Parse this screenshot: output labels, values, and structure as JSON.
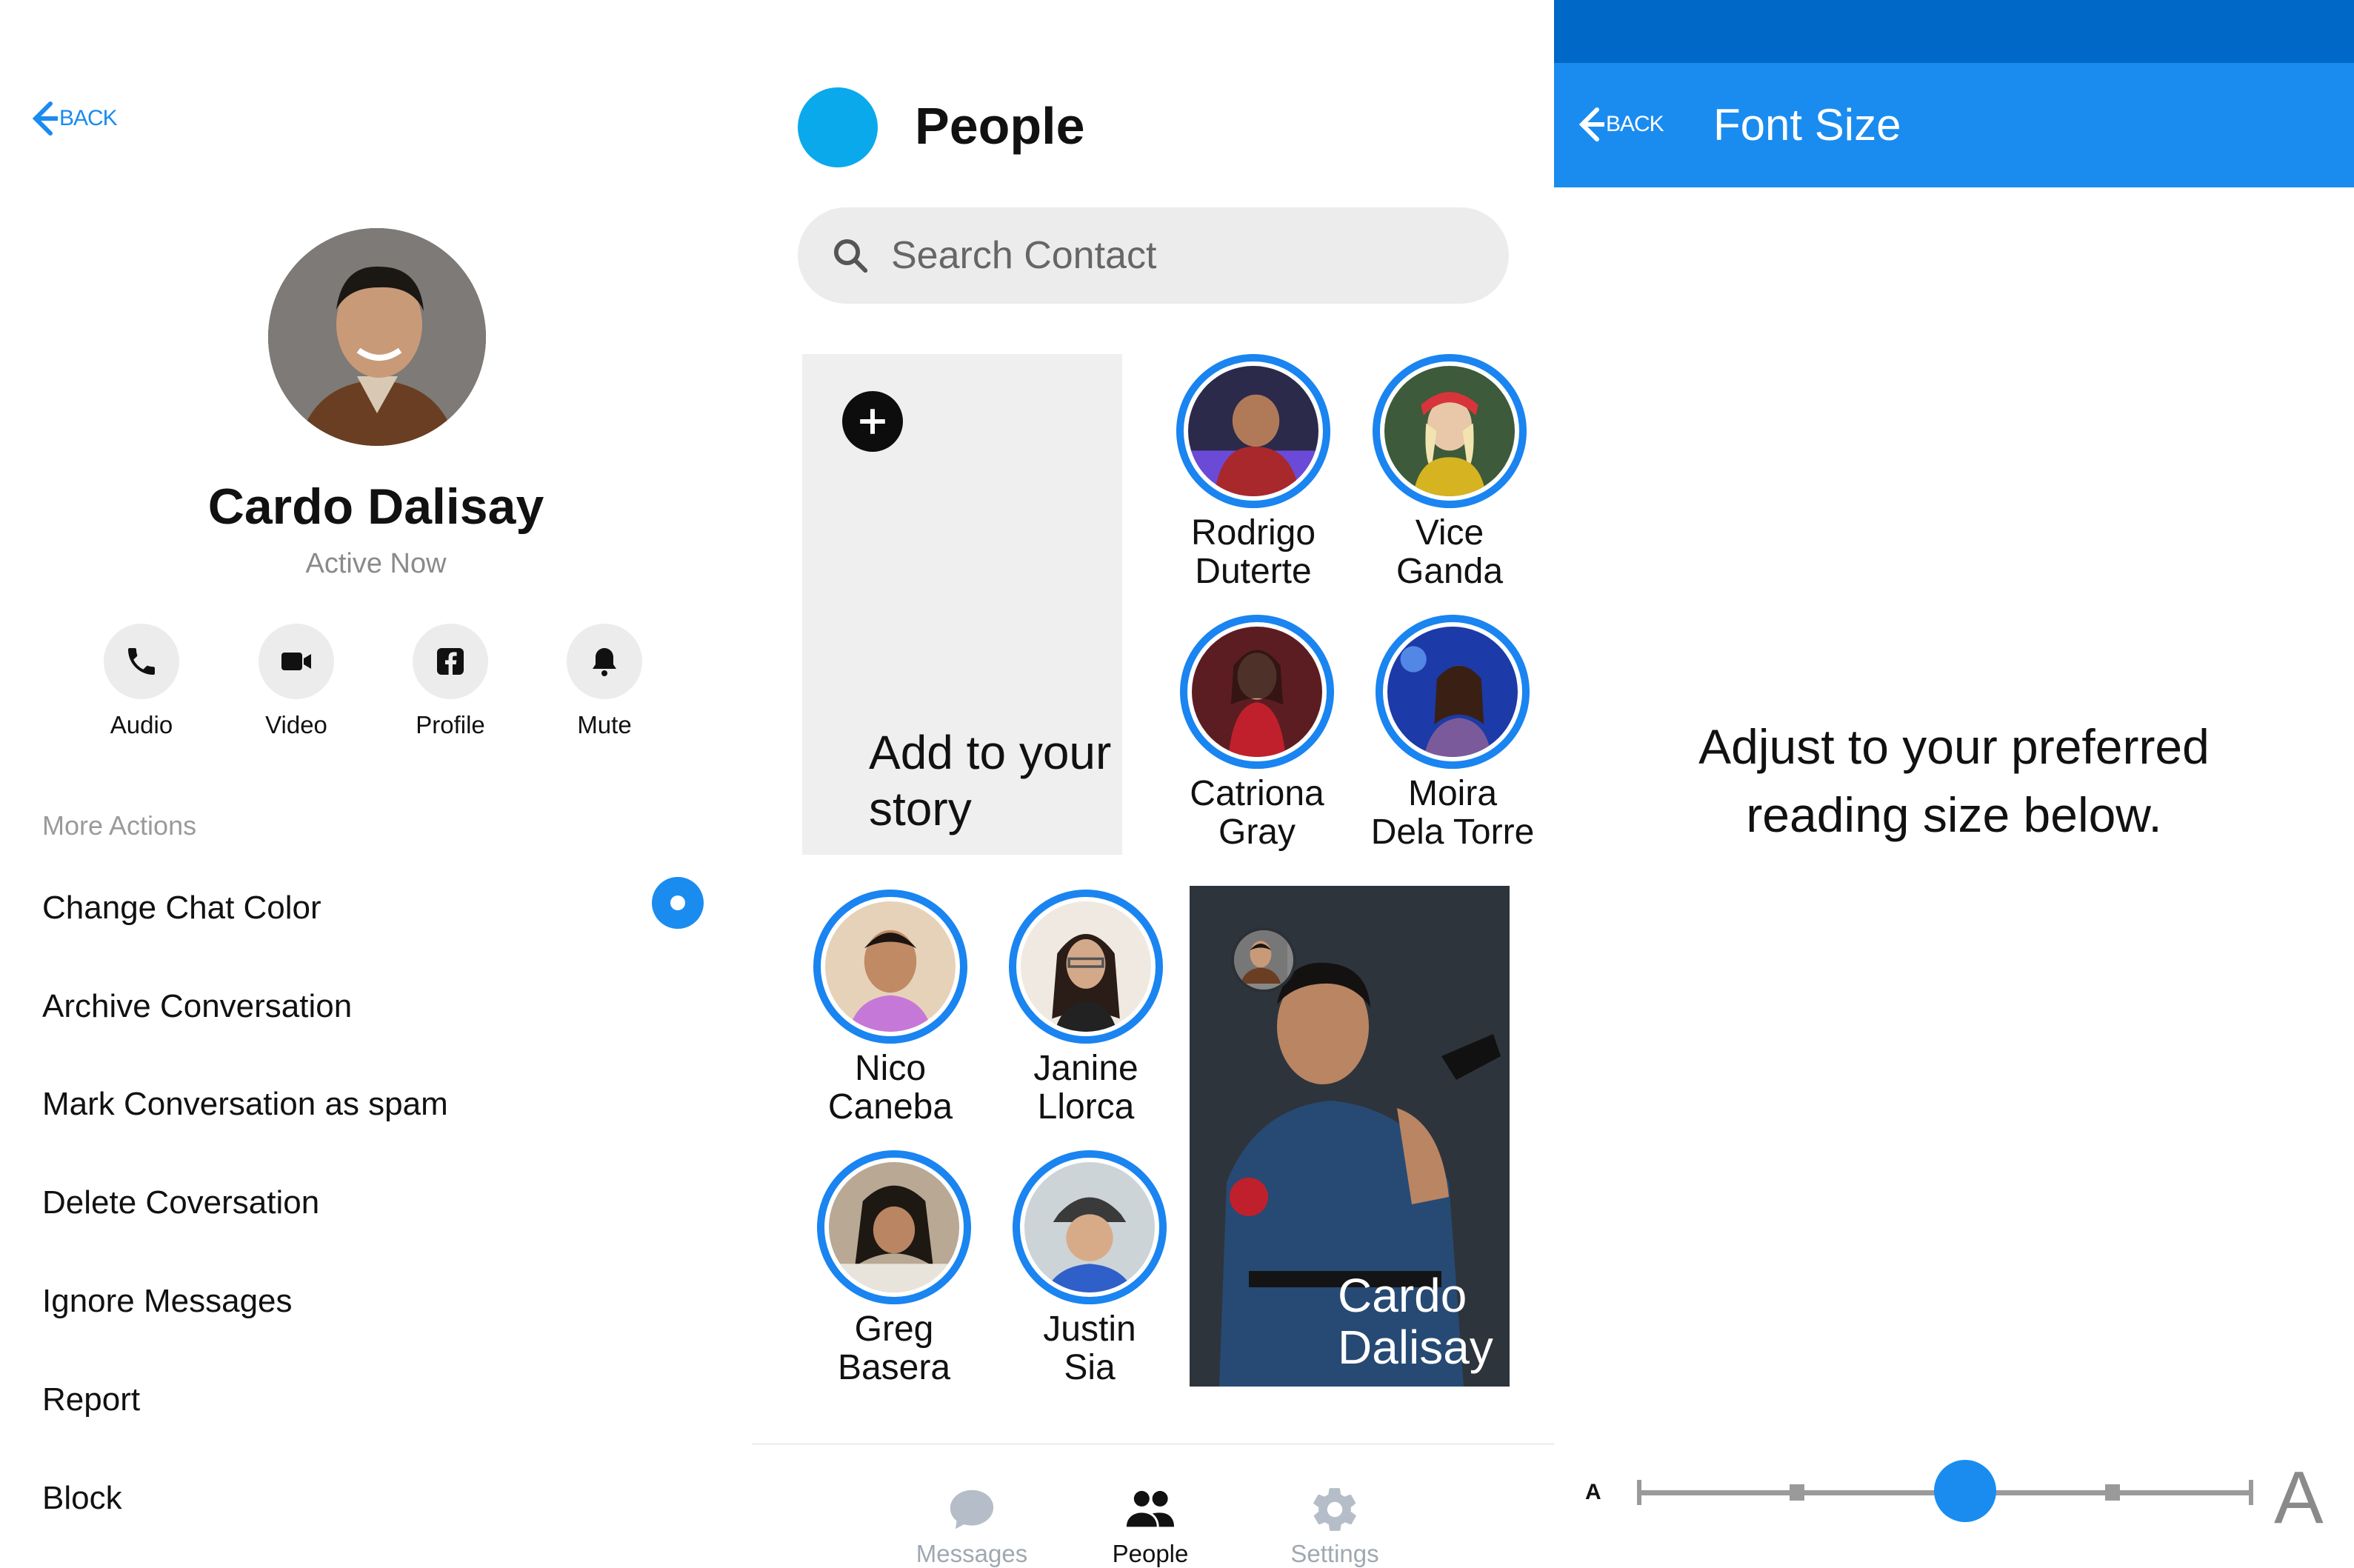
{
  "profile": {
    "back_label": "BACK",
    "name": "Cardo Dalisay",
    "status": "Active Now",
    "actions": [
      {
        "label": "Audio",
        "icon": "phone-icon"
      },
      {
        "label": "Video",
        "icon": "video-camera-icon"
      },
      {
        "label": "Profile",
        "icon": "facebook-icon"
      },
      {
        "label": "Mute",
        "icon": "bell-icon"
      }
    ],
    "more_actions_title": "More Actions",
    "menu": [
      "Change Chat Color",
      "Archive Conversation",
      "Mark Conversation as spam",
      "Delete Coversation",
      "Ignore Messages",
      "Report",
      "Block"
    ],
    "chat_color": "#1a8cf0"
  },
  "people": {
    "title": "People",
    "search_placeholder": "Search Contact",
    "add_story_label": "Add to your story",
    "contacts": [
      {
        "first": "Rodrigo",
        "last": "Duterte"
      },
      {
        "first": "Vice",
        "last": "Ganda"
      },
      {
        "first": "Catriona",
        "last": "Gray"
      },
      {
        "first": "Moira",
        "last": "Dela Torre"
      },
      {
        "first": "Nico",
        "last": "Caneba"
      },
      {
        "first": "Janine",
        "last": "Llorca"
      },
      {
        "first": "Greg",
        "last": "Basera"
      },
      {
        "first": "Justin",
        "last": "Sia"
      }
    ],
    "featured_story": {
      "first": "Cardo",
      "last": "Dalisay"
    },
    "tabs": [
      {
        "label": "Messages",
        "icon": "chat-bubble-icon",
        "active": false
      },
      {
        "label": "People",
        "icon": "people-icon",
        "active": true
      },
      {
        "label": "Settings",
        "icon": "gear-icon",
        "active": false
      }
    ]
  },
  "font_size": {
    "back_label": "BACK",
    "title": "Font Size",
    "description_line1": "Adjust to your preferred",
    "description_line2": "reading size below.",
    "small_label": "A",
    "large_label": "A",
    "slider_level": 0.5,
    "accent": "#1a8cf0"
  }
}
